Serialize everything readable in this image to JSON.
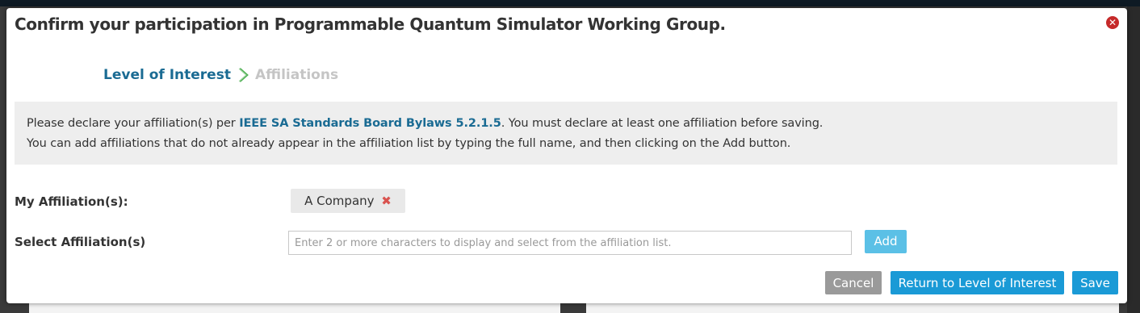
{
  "dialog": {
    "title": "Confirm your participation in Programmable Quantum Simulator Working Group.",
    "close_icon": "close-icon"
  },
  "steps": {
    "active": "Level of Interest",
    "inactive": "Affiliations",
    "separator_icon": "chevron-right-icon"
  },
  "info": {
    "line1_prefix": "Please declare your affiliation(s) per ",
    "line1_link": "IEEE SA Standards Board Bylaws 5.2.1.5",
    "line1_suffix": ". You must declare at least one affiliation before saving.",
    "line2": "You can add affiliations that do not already appear in the affiliation list by typing the full name, and then clicking on the Add button."
  },
  "affiliations": {
    "label": "My Affiliation(s):",
    "items": [
      {
        "name": "A Company",
        "remove_glyph": "✖",
        "remove_icon": "remove-icon"
      }
    ]
  },
  "select": {
    "label": "Select Affiliation(s)",
    "placeholder": "Enter 2 or more characters to display and select from the affiliation list.",
    "value": "",
    "add_label": "Add"
  },
  "footer": {
    "cancel_label": "Cancel",
    "return_label": "Return to Level of Interest",
    "save_label": "Save"
  },
  "colors": {
    "accent": "#1a9ad6",
    "link": "#1a6b93",
    "remove": "#d9534f",
    "close": "#c62a2a"
  }
}
